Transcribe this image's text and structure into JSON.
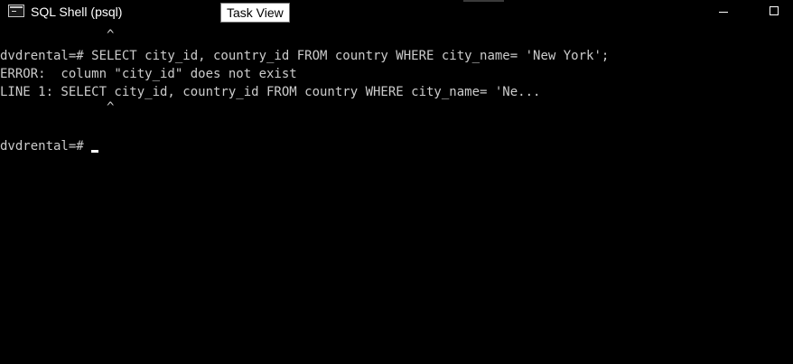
{
  "window": {
    "title": "SQL Shell (psql)",
    "tooltip": "Task View"
  },
  "terminal": {
    "lines": [
      "              ^",
      "dvdrental=# SELECT city_id, country_id FROM country WHERE city_name= 'New York';",
      "ERROR:  column \"city_id\" does not exist",
      "LINE 1: SELECT city_id, country_id FROM country WHERE city_name= 'Ne...",
      "              ^",
      "",
      "dvdrental=#"
    ]
  },
  "colors": {
    "background": "#000000",
    "text": "#cccccc",
    "title": "#ffffff"
  }
}
